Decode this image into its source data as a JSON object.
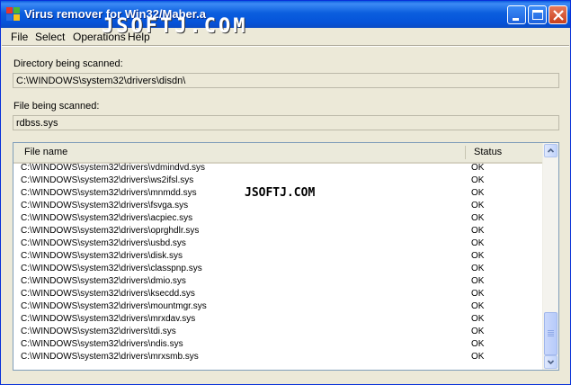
{
  "window": {
    "title": "Virus remover for Win32/Maber.a",
    "watermark": "JSOFTJ.COM"
  },
  "menu": [
    "File",
    "Select",
    "Operations",
    "Help"
  ],
  "directory": {
    "label": "Directory being scanned:",
    "value": "C:\\WINDOWS\\system32\\drivers\\disdn\\"
  },
  "file": {
    "label": "File being scanned:",
    "value": "rdbss.sys"
  },
  "list": {
    "columns": [
      "File name",
      "Status"
    ],
    "rows": [
      {
        "name": "C:\\WINDOWS\\system32\\drivers\\vdmindvd.sys",
        "status": "OK"
      },
      {
        "name": "C:\\WINDOWS\\system32\\drivers\\ws2ifsl.sys",
        "status": "OK"
      },
      {
        "name": "C:\\WINDOWS\\system32\\drivers\\mnmdd.sys",
        "status": "OK"
      },
      {
        "name": "C:\\WINDOWS\\system32\\drivers\\fsvga.sys",
        "status": "OK"
      },
      {
        "name": "C:\\WINDOWS\\system32\\drivers\\acpiec.sys",
        "status": "OK"
      },
      {
        "name": "C:\\WINDOWS\\system32\\drivers\\oprghdlr.sys",
        "status": "OK"
      },
      {
        "name": "C:\\WINDOWS\\system32\\drivers\\usbd.sys",
        "status": "OK"
      },
      {
        "name": "C:\\WINDOWS\\system32\\drivers\\disk.sys",
        "status": "OK"
      },
      {
        "name": "C:\\WINDOWS\\system32\\drivers\\classpnp.sys",
        "status": "OK"
      },
      {
        "name": "C:\\WINDOWS\\system32\\drivers\\dmio.sys",
        "status": "OK"
      },
      {
        "name": "C:\\WINDOWS\\system32\\drivers\\ksecdd.sys",
        "status": "OK"
      },
      {
        "name": "C:\\WINDOWS\\system32\\drivers\\mountmgr.sys",
        "status": "OK"
      },
      {
        "name": "C:\\WINDOWS\\system32\\drivers\\mrxdav.sys",
        "status": "OK"
      },
      {
        "name": "C:\\WINDOWS\\system32\\drivers\\tdi.sys",
        "status": "OK"
      },
      {
        "name": "C:\\WINDOWS\\system32\\drivers\\ndis.sys",
        "status": "OK"
      },
      {
        "name": "C:\\WINDOWS\\system32\\drivers\\mrxsmb.sys",
        "status": "OK"
      }
    ]
  },
  "watermark_center": "JSOFTJ.COM"
}
